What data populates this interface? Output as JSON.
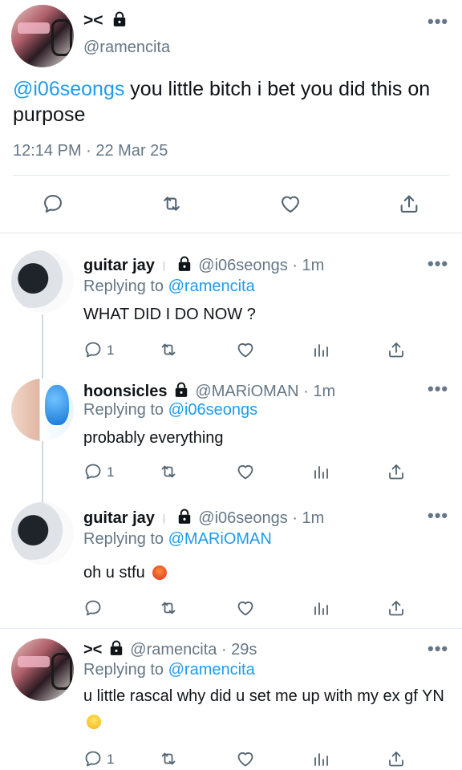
{
  "main_tweet": {
    "display_name": "><",
    "handle": "@ramencita",
    "mention": "@i06seongs",
    "text": " you little bitch i bet you did this on purpose",
    "timestamp": "12:14 PM · 22 Mar 25"
  },
  "replies": [
    {
      "display_name": "guitar jay",
      "handle": "@i06seongs · 1m",
      "replying_label": "Replying to",
      "replying_to": "@ramencita",
      "text": "WHAT DID I DO NOW ?",
      "reply_count": "1"
    },
    {
      "display_name": "hoonsicles",
      "handle": "@MARiOMAN · 1m",
      "replying_label": "Replying to",
      "replying_to": "@i06seongs",
      "text": "probably everything",
      "reply_count": "1"
    },
    {
      "display_name": "guitar jay",
      "handle": "@i06seongs · 1m",
      "replying_label": "Replying to",
      "replying_to": "@MARiOMAN",
      "text": "oh u stfu",
      "reply_count": ""
    },
    {
      "display_name": "><",
      "handle": "@ramencita · 29s",
      "replying_label": "Replying to",
      "replying_to": "@ramencita",
      "text": "u little rascal why did u set me up with my ex gf YN",
      "reply_count": "1"
    }
  ],
  "more_label": "•••",
  "icons": {
    "reply": "reply-icon",
    "retweet": "retweet-icon",
    "like": "heart-icon",
    "views": "views-icon",
    "share": "share-icon",
    "lock": "lock-icon"
  },
  "colors": {
    "link": "#1d9bf0",
    "muted": "#657786"
  }
}
